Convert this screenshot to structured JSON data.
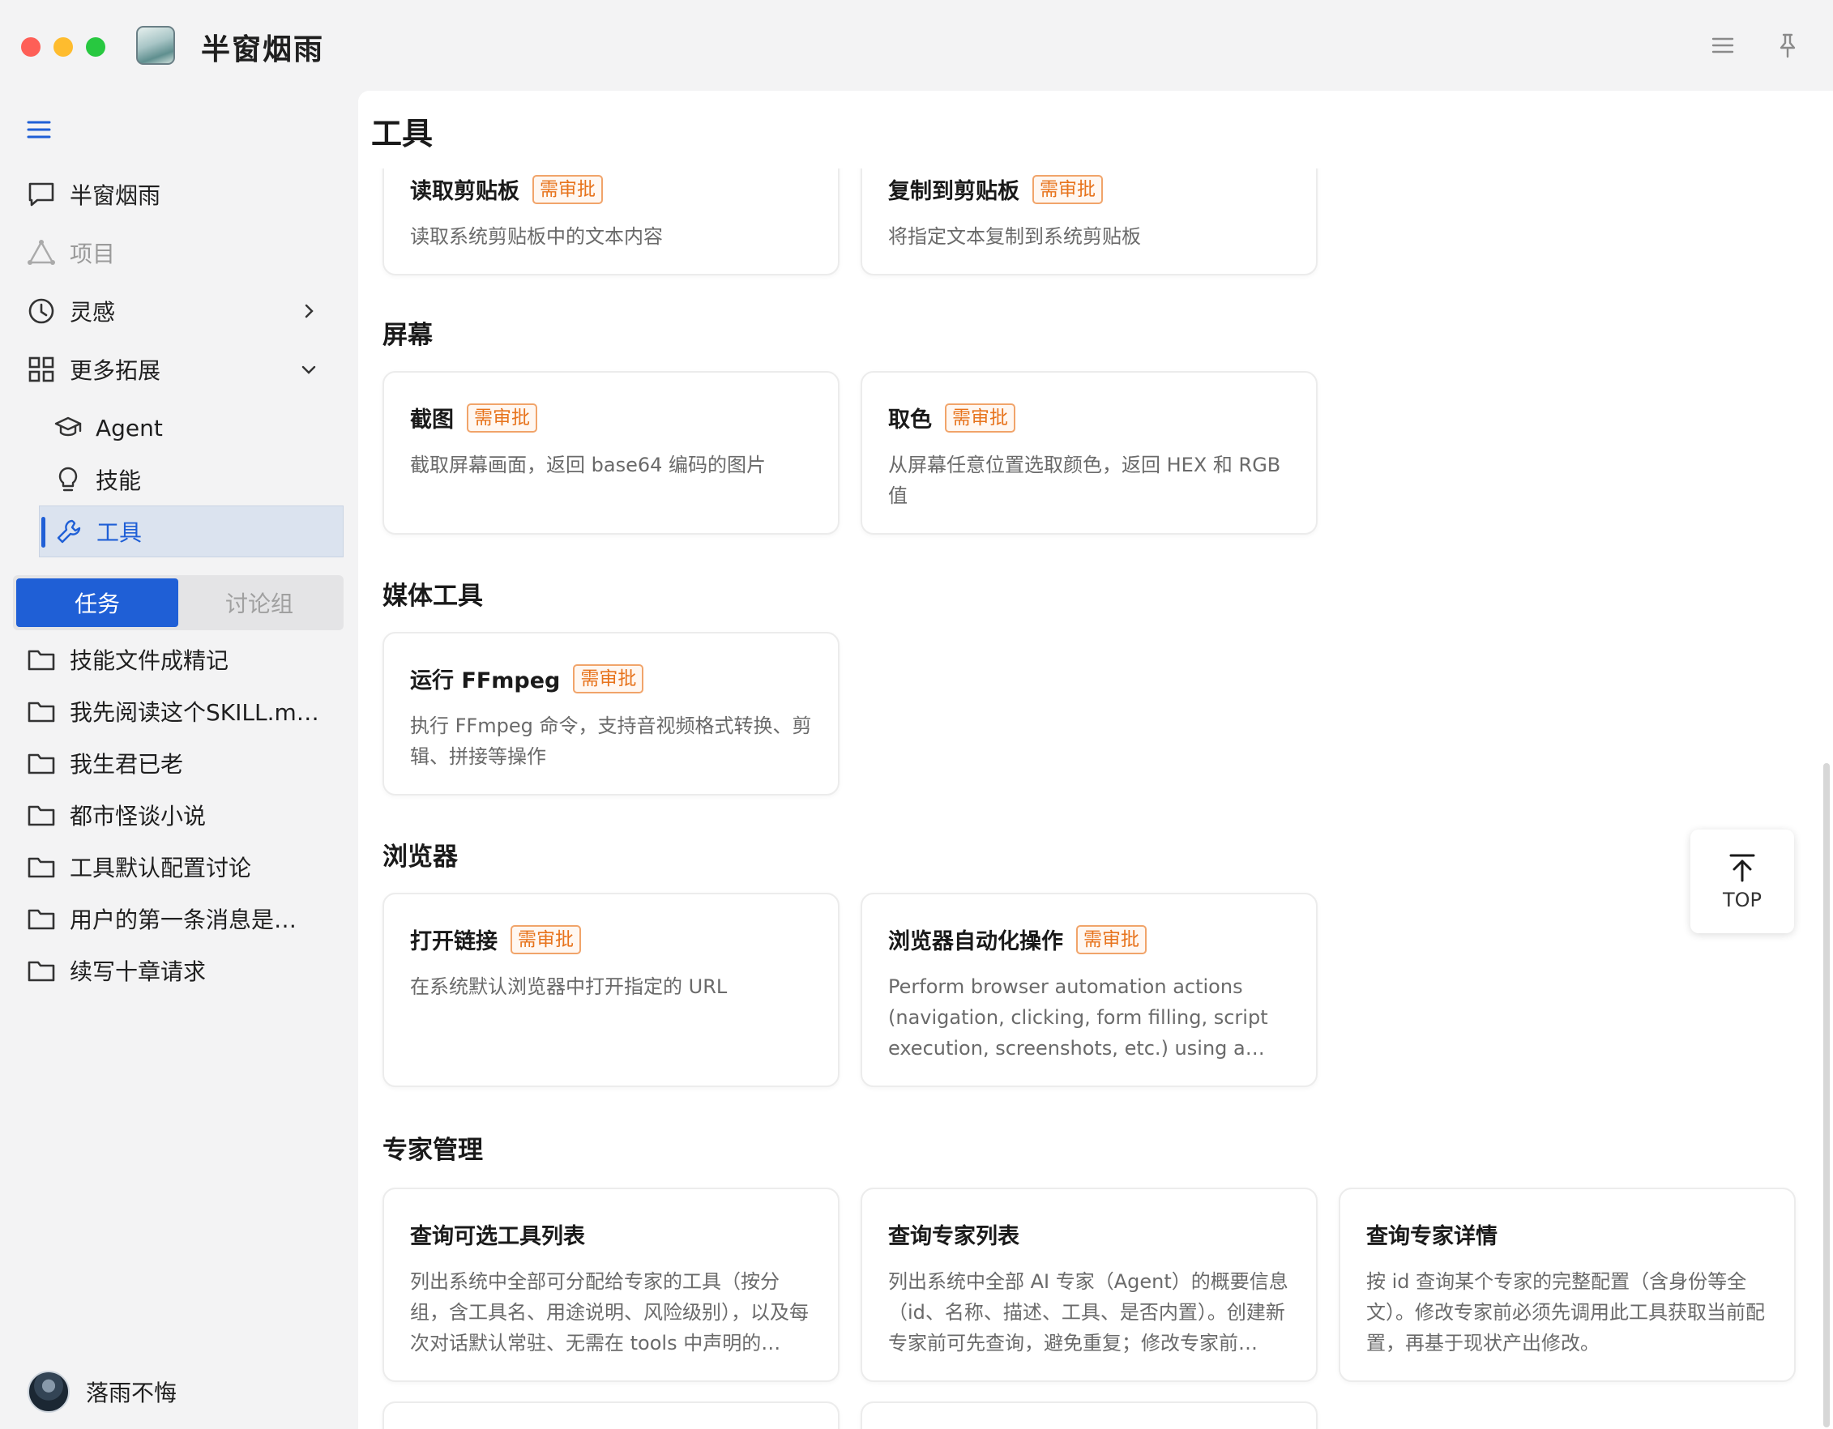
{
  "app": {
    "title": "半窗烟雨"
  },
  "sidebar": {
    "nav": [
      {
        "label": "半窗烟雨"
      },
      {
        "label": "项目"
      },
      {
        "label": "灵感"
      },
      {
        "label": "更多拓展"
      }
    ],
    "sub": [
      {
        "label": "Agent"
      },
      {
        "label": "技能"
      },
      {
        "label": "工具"
      }
    ],
    "tabs": {
      "active": "任务",
      "inactive": "讨论组"
    },
    "tasks": [
      "技能文件成精记",
      "我先阅读这个SKILL.m…",
      "我生君已老",
      "都市怪谈小说",
      "工具默认配置讨论",
      "用户的第一条消息是…",
      "续写十章请求"
    ],
    "user": "落雨不悔"
  },
  "main": {
    "title": "工具",
    "sections": [
      {
        "title": "屏幕"
      },
      {
        "title": "媒体工具"
      },
      {
        "title": "浏览器"
      },
      {
        "title": "专家管理"
      }
    ],
    "cards": [
      {
        "name": "读取剪贴板",
        "badge": "需审批",
        "desc": "读取系统剪贴板中的文本内容"
      },
      {
        "name": "复制到剪贴板",
        "badge": "需审批",
        "desc": "将指定文本复制到系统剪贴板"
      },
      {
        "name": "截图",
        "badge": "需审批",
        "desc": "截取屏幕画面，返回 base64 编码的图片"
      },
      {
        "name": "取色",
        "badge": "需审批",
        "desc": "从屏幕任意位置选取颜色，返回 HEX 和 RGB 值"
      },
      {
        "name": "运行 FFmpeg",
        "badge": "需审批",
        "desc": "执行 FFmpeg 命令，支持音视频格式转换、剪辑、拼接等操作"
      },
      {
        "name": "打开链接",
        "badge": "需审批",
        "desc": "在系统默认浏览器中打开指定的 URL"
      },
      {
        "name": "浏览器自动化操作",
        "badge": "需审批",
        "desc": "Perform browser automation actions (navigation, clicking, form filling, script execution, screenshots, etc.) using a…"
      },
      {
        "name": "查询可选工具列表",
        "desc": "列出系统中全部可分配给专家的工具（按分组，含工具名、用途说明、风险级别），以及每次对话默认常驻、无需在 tools 中声明的…"
      },
      {
        "name": "查询专家列表",
        "desc": "列出系统中全部 AI 专家（Agent）的概要信息（id、名称、描述、工具、是否内置）。创建新专家前可先查询，避免重复；修改专家前…"
      },
      {
        "name": "查询专家详情",
        "desc": "按 id 查询某个专家的完整配置（含身份等全文）。修改专家前必须先调用此工具获取当前配置，再基于现状产出修改。"
      }
    ],
    "top_button": "TOP"
  }
}
